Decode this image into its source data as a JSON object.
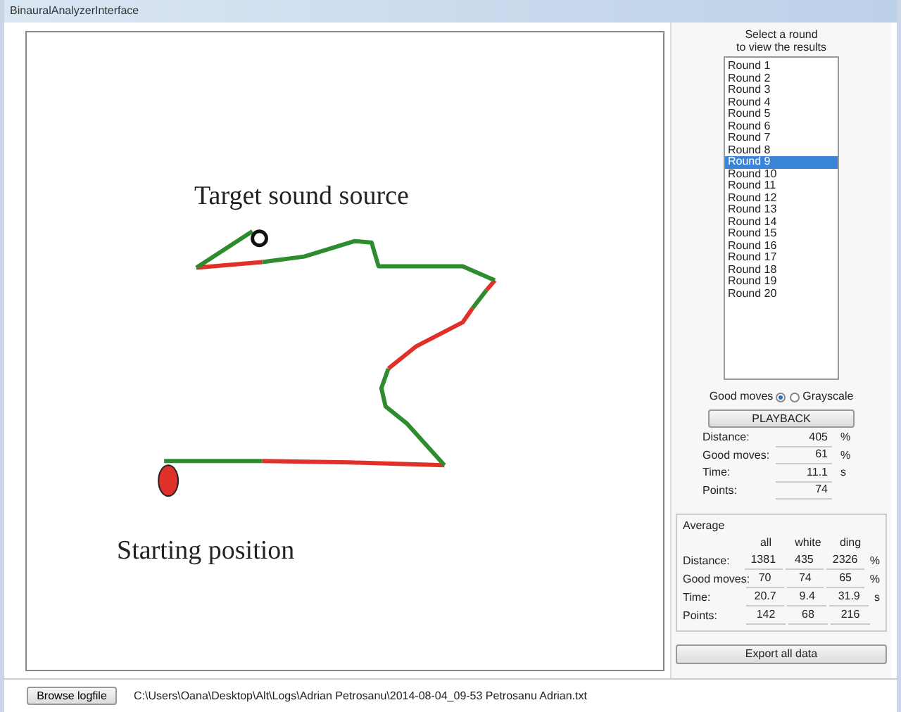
{
  "window": {
    "title": "BinauralAnalyzerInterface"
  },
  "canvas": {
    "target_label": "Target sound source",
    "start_label": "Starting position"
  },
  "rounds": {
    "caption_lines": [
      "Select a round",
      "to view the results"
    ],
    "items": [
      {
        "label": "Round 1",
        "selected": false
      },
      {
        "label": "Round 2",
        "selected": false
      },
      {
        "label": "Round 3",
        "selected": false
      },
      {
        "label": "Round 4",
        "selected": false
      },
      {
        "label": "Round 5",
        "selected": false
      },
      {
        "label": "Round 6",
        "selected": false
      },
      {
        "label": "Round 7",
        "selected": false
      },
      {
        "label": "Round 8",
        "selected": false
      },
      {
        "label": "Round 9",
        "selected": true
      },
      {
        "label": "Round 10",
        "selected": false
      },
      {
        "label": "Round 11",
        "selected": false
      },
      {
        "label": "Round 12",
        "selected": false
      },
      {
        "label": "Round 13",
        "selected": false
      },
      {
        "label": "Round 14",
        "selected": false
      },
      {
        "label": "Round 15",
        "selected": false
      },
      {
        "label": "Round 16",
        "selected": false
      },
      {
        "label": "Round 17",
        "selected": false
      },
      {
        "label": "Round 18",
        "selected": false
      },
      {
        "label": "Round 19",
        "selected": false
      },
      {
        "label": "Round 20",
        "selected": false
      }
    ]
  },
  "display_mode": [
    {
      "label": "Good moves",
      "selected": true
    },
    {
      "label": "Grayscale",
      "selected": false
    }
  ],
  "playback_button": "PLAYBACK",
  "stats": [
    {
      "label": "Distance:",
      "value": "405",
      "unit": "%"
    },
    {
      "label": "Good moves:",
      "value": "61",
      "unit": "%"
    },
    {
      "label": "Time:",
      "value": "11.1",
      "unit": "s"
    },
    {
      "label": "Points:",
      "value": "74"
    }
  ],
  "average": {
    "title": "Average",
    "columns": [
      "all",
      "white",
      "ding"
    ],
    "rows": [
      {
        "label": "Distance:",
        "values": [
          "1381",
          "435",
          "2326"
        ],
        "unit": "%"
      },
      {
        "label": "Good moves:",
        "values": [
          "70",
          "74",
          "65"
        ],
        "unit": "%"
      },
      {
        "label": "Time:",
        "values": [
          "20.7",
          "9.4",
          "31.9"
        ],
        "unit": "s"
      },
      {
        "label": "Points:",
        "values": [
          "142",
          "68",
          "216"
        ]
      }
    ]
  },
  "export_button": "Export all data",
  "browse_button": "Browse logfile",
  "file_path": "C:\\Users\\Oana\\Desktop\\Alt\\Logs\\Adrian Petrosanu\\2014-08-04_09-53 Petrosanu Adrian.txt"
}
